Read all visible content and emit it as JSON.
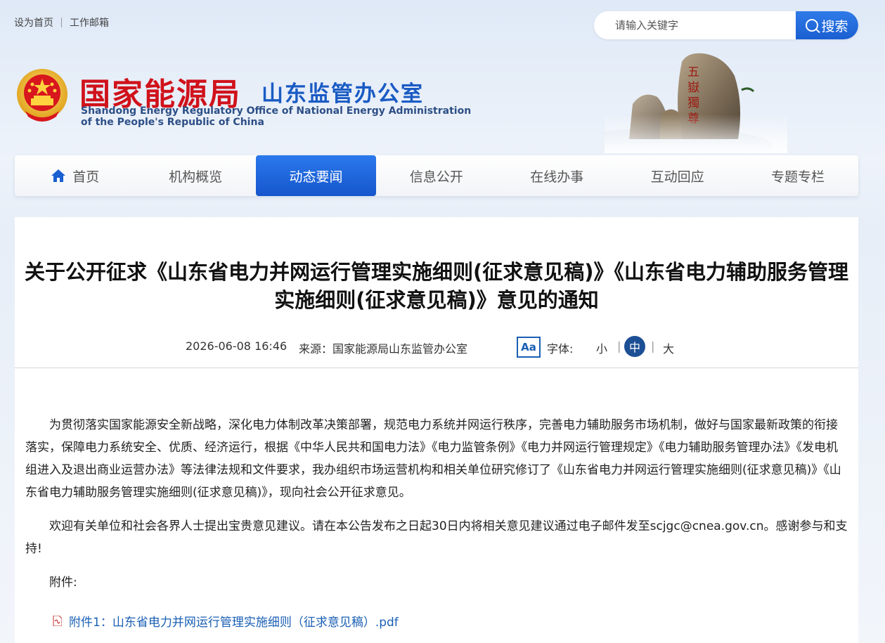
{
  "top_links": {
    "set_home": "设为首页",
    "mail": "工作邮箱"
  },
  "search": {
    "placeholder": "请输入关键字",
    "button_label": "搜索"
  },
  "banner": {
    "org_cn": "国家能源局",
    "office_cn": "山东监管办公室",
    "org_en_line1": "Shandong Energy Regulatory Office of National Energy Administration",
    "org_en_line2": "of the People's Republic of China"
  },
  "nav": {
    "items": [
      {
        "label": "首页"
      },
      {
        "label": "机构概览"
      },
      {
        "label": "动态要闻"
      },
      {
        "label": "信息公开"
      },
      {
        "label": "在线办事"
      },
      {
        "label": "互动回应"
      },
      {
        "label": "专题专栏"
      }
    ],
    "active": "动态要闻"
  },
  "article": {
    "title": "关于公开征求《山东省电力并网运行管理实施细则(征求意见稿)》《山东省电力辅助服务管理实施细则(征求意见稿)》意见的通知",
    "date": "2026-06-08 16:46",
    "source": "来源：国家能源局山东监管办公室",
    "font_label": "字体:",
    "font_icon": "Aa",
    "font_small": "小",
    "font_mid": "中",
    "font_big": "大",
    "paragraph1": "为贯彻落实国家能源安全新战略，深化电力体制改革决策部署，规范电力系统并网运行秩序，完善电力辅助服务市场机制，做好与国家最新政策的衔接落实，保障电力系统安全、优质、经济运行，根据《中华人民共和国电力法》《电力监管条例》《电力并网运行管理规定》《电力辅助服务管理办法》《发电机组进入及退出商业运营办法》等法律法规和文件要求，我办组织市场运营机构和相关单位研究修订了《山东省电力并网运行管理实施细则(征求意见稿)》《山东省电力辅助服务管理实施细则(征求意见稿)》，现向社会公开征求意见。",
    "paragraph2": "欢迎有关单位和社会各界人士提出宝贵意见建议。请在本公告发布之日起30日内将相关意见建议通过电子邮件发至scjgc@cnea.gov.cn。感谢参与和支持!",
    "attachments_label": "附件:",
    "attachment1": "附件1：山东省电力并网运行管理实施细则（征求意见稿）.pdf"
  },
  "colors": {
    "accent": "#1a5fd1",
    "org_red": "#d0121b",
    "office_blue": "#1a5bc4",
    "link": "#1a5fb4"
  }
}
